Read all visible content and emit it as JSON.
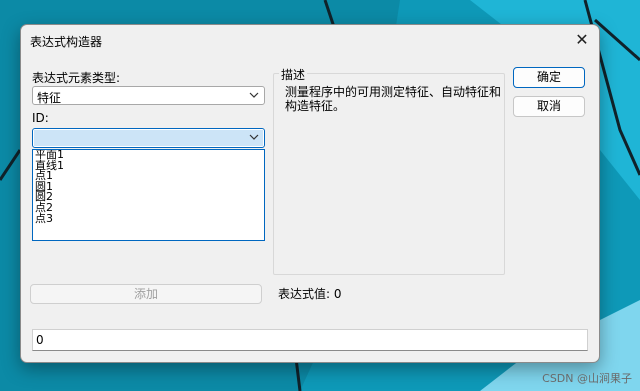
{
  "dialog": {
    "title": "表达式构造器",
    "element_type_label": "表达式元素类型:",
    "element_type_value": "特征",
    "id_label": "ID:",
    "id_value": "",
    "id_options": [
      "平面1",
      "直线1",
      "点1",
      "圆1",
      "圆2",
      "点2",
      "点3"
    ],
    "description_title": "描述",
    "description_text": "测量程序中的可用测定特征、自动特征和构造特征。",
    "ok_label": "确定",
    "cancel_label": "取消",
    "add_label": "添加",
    "expression_value_label": "表达式值: 0",
    "expression_input": "0"
  },
  "watermark": "CSDN @山涧果子",
  "colors": {
    "accent": "#0067c0",
    "background": "#0a7f98",
    "dialog": "#f0f0f0"
  },
  "icons": [
    "close-icon",
    "chevron-down-icon"
  ]
}
